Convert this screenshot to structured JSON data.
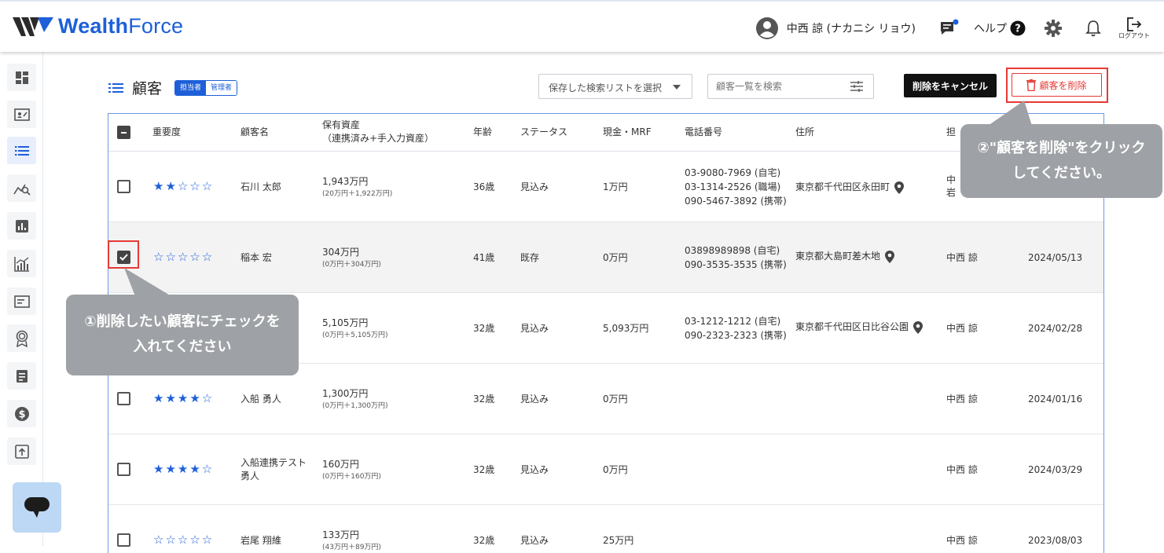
{
  "header": {
    "logo_text_bold": "Wealth",
    "logo_text_light": "Force",
    "user_name": "中西 諒 (ナカニシ リョウ)",
    "help_label": "ヘルプ",
    "logout_label": "ログアウト"
  },
  "sidebar": {
    "items": [
      "dashboard-icon",
      "profile-card-icon",
      "list-icon",
      "analytics-search-icon",
      "bar-chart-icon",
      "growth-chart-icon",
      "document-icon",
      "award-icon",
      "notes-icon",
      "dollar-icon",
      "upload-icon"
    ],
    "active": "list-icon"
  },
  "page": {
    "title": "顧客",
    "role_on": "担当者",
    "role_off": "管理者",
    "saved_search_placeholder": "保存した検索リストを選択",
    "search_placeholder": "顧客一覧を検索",
    "cancel_delete_label": "削除をキャンセル",
    "delete_label": "顧客を削除"
  },
  "table": {
    "columns": {
      "importance": "重要度",
      "name": "顧客名",
      "assets": "保有資産",
      "assets_sub": "（連携済み+手入力資産）",
      "age": "年齢",
      "status": "ステータス",
      "cash": "現金・MRF",
      "phone": "電話番号",
      "address": "住所",
      "owner": "担"
    },
    "rows": [
      {
        "checked": false,
        "stars": "★★☆☆☆",
        "name": "石川 太郎",
        "assets": "1,943万円",
        "assets_sub": "(20万円＋1,922万円)",
        "age": "36歳",
        "status": "見込み",
        "cash": "1万円",
        "phone1": "03-9080-7969 (自宅)",
        "phone2": "03-1314-2526 (職場)",
        "phone3": "090-5467-3892 (携帯)",
        "address": "東京都千代田区永田町",
        "owner": "中",
        "owner2": "岩",
        "date": ""
      },
      {
        "checked": true,
        "stars": "☆☆☆☆☆",
        "name": "稲本 宏",
        "assets": "304万円",
        "assets_sub": "(0万円＋304万円)",
        "age": "41歳",
        "status": "既存",
        "cash": "0万円",
        "phone1": "03898989898 (自宅)",
        "phone2": "090-3535-3535 (携帯)",
        "phone3": "",
        "address": "東京都大島町差木地",
        "owner": "中西 諒",
        "owner2": "",
        "date": "2024/05/13"
      },
      {
        "checked": false,
        "stars": "",
        "name": "",
        "assets": "5,105万円",
        "assets_sub": "(0万円＋5,105万円)",
        "age": "32歳",
        "status": "見込み",
        "cash": "5,093万円",
        "phone1": "03-1212-1212 (自宅)",
        "phone2": "090-2323-2323 (携帯)",
        "phone3": "",
        "address": "東京都千代田区日比谷公園",
        "owner": "中西 諒",
        "owner2": "",
        "date": "2024/02/28"
      },
      {
        "checked": false,
        "stars": "★★★★☆",
        "name": "入船 勇人",
        "assets": "1,300万円",
        "assets_sub": "(0万円＋1,300万円)",
        "age": "32歳",
        "status": "見込み",
        "cash": "0万円",
        "phone1": "",
        "phone2": "",
        "phone3": "",
        "address": "",
        "owner": "中西 諒",
        "owner2": "",
        "date": "2024/01/16"
      },
      {
        "checked": false,
        "stars": "★★★★☆",
        "name": "入船連携テスト",
        "name2": "勇人",
        "assets": "160万円",
        "assets_sub": "(0万円＋160万円)",
        "age": "32歳",
        "status": "見込み",
        "cash": "0万円",
        "phone1": "",
        "phone2": "",
        "phone3": "",
        "address": "",
        "owner": "中西 諒",
        "owner2": "",
        "date": "2024/03/29"
      },
      {
        "checked": false,
        "stars": "☆☆☆☆☆",
        "name": "岩尾 翔維",
        "assets": "133万円",
        "assets_sub": "(43万円＋89万円)",
        "age": "32歳",
        "status": "見込み",
        "cash": "25万円",
        "phone1": "",
        "phone2": "",
        "phone3": "",
        "address": "",
        "owner": "中西 諒",
        "owner2": "",
        "date": "2023/08/03"
      }
    ]
  },
  "callouts": {
    "step1_line1": "①削除したい顧客にチェックを",
    "step1_line2": "入れてください",
    "step2_line1": "②\"顧客を削除\"をクリック",
    "step2_line2": "してください。"
  },
  "colors": {
    "brand": "#1e5fd8",
    "danger": "#e53935",
    "callout": "#9ea1a5"
  }
}
